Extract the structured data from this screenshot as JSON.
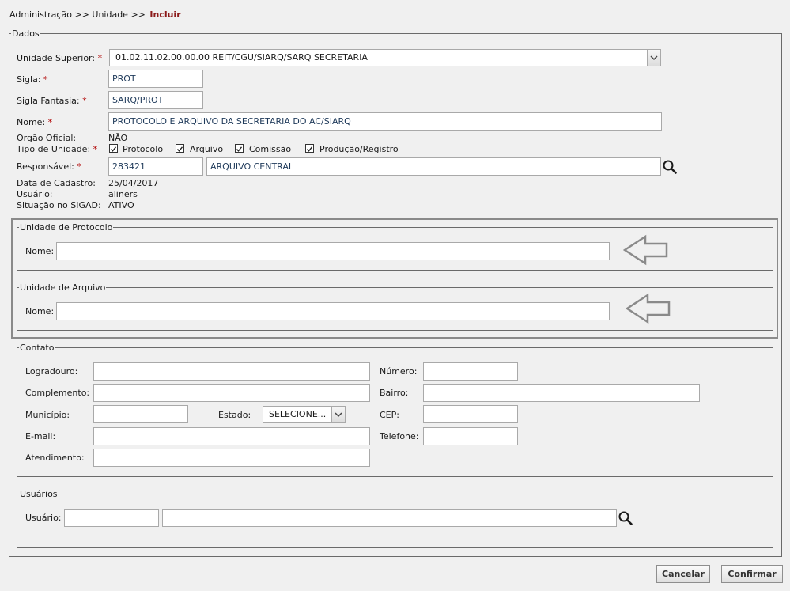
{
  "breadcrumb": {
    "part1": "Administração",
    "sep1": ">>",
    "part2": "Unidade",
    "sep2": ">>",
    "current": "Incluir"
  },
  "dados": {
    "legend": "Dados",
    "unidade_superior": {
      "label": "Unidade Superior:",
      "value": "01.02.11.02.00.00.00 REIT/CGU/SIARQ/SARQ SECRETARIA"
    },
    "sigla": {
      "label": "Sigla:",
      "value": "PROT"
    },
    "sigla_fantasia": {
      "label": "Sigla Fantasia:",
      "value": "SARQ/PROT"
    },
    "nome": {
      "label": "Nome:",
      "value": "PROTOCOLO E ARQUIVO DA SECRETARIA DO AC/SIARQ"
    },
    "orgao_oficial": {
      "label": "Orgão Oficial:",
      "value": "NÃO"
    },
    "tipo_unidade": {
      "label": "Tipo de Unidade:",
      "options": [
        {
          "label": "Protocolo",
          "checked": true
        },
        {
          "label": "Arquivo",
          "checked": true
        },
        {
          "label": "Comissão",
          "checked": true
        },
        {
          "label": "Produção/Registro",
          "checked": true
        }
      ]
    },
    "responsavel": {
      "label": "Responsável:",
      "code": "283421",
      "name": "ARQUIVO CENTRAL"
    },
    "data_cadastro": {
      "label": "Data de Cadastro:",
      "value": "25/04/2017"
    },
    "usuario": {
      "label": "Usuário:",
      "value": "aliners"
    },
    "situacao": {
      "label": "Situação no SIGAD:",
      "value": "ATIVO"
    },
    "required_mark": "*"
  },
  "unidade_protocolo": {
    "legend": "Unidade de Protocolo",
    "nome_label": "Nome:",
    "nome_value": ""
  },
  "unidade_arquivo": {
    "legend": "Unidade de Arquivo",
    "nome_label": "Nome:",
    "nome_value": ""
  },
  "contato": {
    "legend": "Contato",
    "logradouro_label": "Logradouro:",
    "numero_label": "Número:",
    "complemento_label": "Complemento:",
    "bairro_label": "Bairro:",
    "municipio_label": "Município:",
    "estado_label": "Estado:",
    "estado_value": "SELECIONE...",
    "cep_label": "CEP:",
    "email_label": "E-mail:",
    "telefone_label": "Telefone:",
    "atendimento_label": "Atendimento:"
  },
  "usuarios": {
    "legend": "Usuários",
    "usuario_label": "Usuário:"
  },
  "buttons": {
    "cancel": "Cancelar",
    "confirm": "Confirmar"
  },
  "colors": {
    "current_breadcrumb": "#8b1a1a",
    "required": "#b00000",
    "highlight_border": "#8a8a8a"
  },
  "icons": {
    "search": "search-icon",
    "arrow": "left-arrow-icon",
    "check": "check-icon",
    "dropdown": "chevron-down-icon"
  }
}
